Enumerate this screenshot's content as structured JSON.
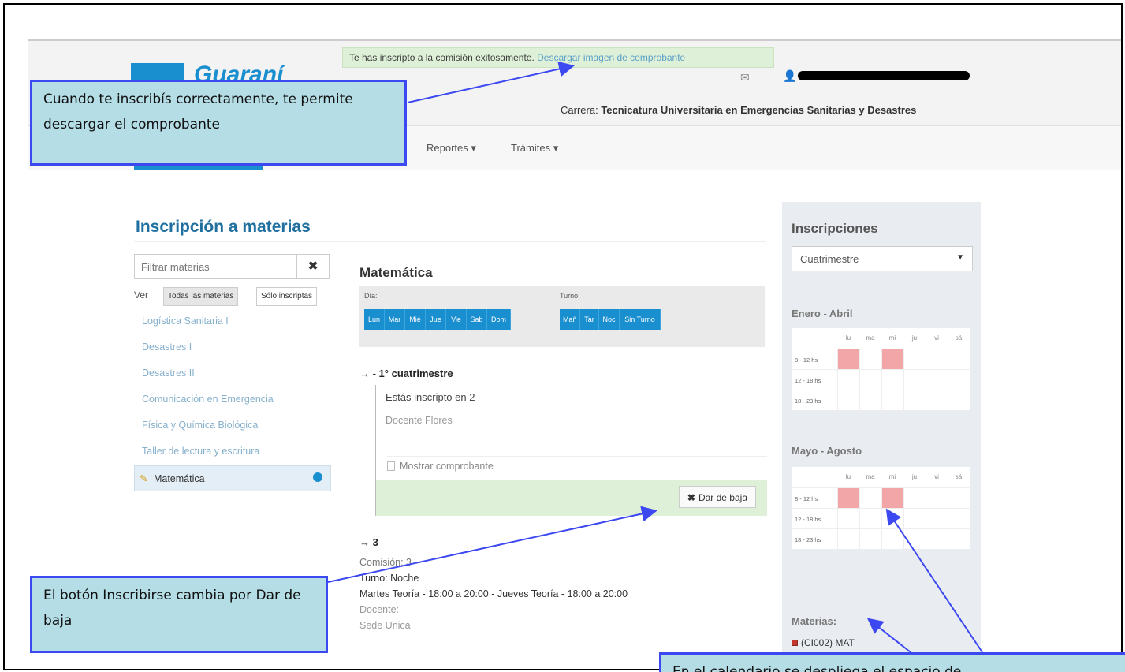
{
  "header": {
    "logo_text": "Guaraní",
    "success_message": "Te has inscripto a la comisión exitosamente.",
    "success_link": "Descargar imagen de comprobante",
    "carrera_label": "Carrera:",
    "carrera_value": "Tecnicatura Universitaria en Emergencias Sanitarias y Desastres"
  },
  "nav": {
    "items": [
      "Reportes ▾",
      "Trámites ▾"
    ]
  },
  "page": {
    "title": "Inscripción a materias"
  },
  "filter": {
    "placeholder": "Filtrar materias",
    "clear_icon": "✖",
    "ver_label": "Ver",
    "toggle_all": "Todas las materias",
    "toggle_inscriptas": "Sólo inscriptas"
  },
  "materias": [
    "Logística Sanitaria I",
    "Desastres I",
    "Desastres II",
    "Comunicación en Emergencia",
    "Física y Química Biológica",
    "Taller de lectura y escritura",
    "Matemática"
  ],
  "detail": {
    "title": "Matemática",
    "dia_label": "Día:",
    "turno_label": "Turno:",
    "dias": [
      "Lun",
      "Mar",
      "Mié",
      "Jue",
      "Vie",
      "Sab",
      "Dom"
    ],
    "turnos": [
      "Mañ",
      "Tar",
      "Noc",
      "Sin Turno"
    ],
    "cuat_heading": "→ - 1° cuatrimestre",
    "estas_inscripto": "Estás inscripto en 2",
    "docente": "Docente Flores",
    "mostrar_comprobante": "Mostrar comprobante",
    "baja_icon": "✖",
    "baja_label": "Dar de baja",
    "c3_heading": "→ 3",
    "c3_lines": [
      "Comisión: 3",
      "Turno: Noche",
      "Martes Teoría - 18:00 a 20:00 - Jueves Teoría - 18:00 a 20:00",
      "Docente:",
      "Sede Unica"
    ]
  },
  "sidebar": {
    "title": "Inscripciones",
    "period_select": "Cuatrimestre",
    "block1_title": "Enero - Abril",
    "block2_title": "Mayo - Agosto",
    "days": [
      "lu",
      "ma",
      "mi",
      "ju",
      "vi",
      "sá"
    ],
    "slots": [
      "8 - 12 hs",
      "12 - 18 hs",
      "18 - 23 hs"
    ],
    "materias_title": "Materias:",
    "materia_entry": "(CI002) MAT"
  },
  "annotations": {
    "callout1": "Cuando te inscribís correctamente, te permite descargar el comprobante",
    "callout2": "El botón Inscribirse cambia por Dar de baja",
    "callout3": "En el calendario se despliega el espacio de"
  },
  "colors": {
    "brand": "#1a8fd0",
    "success_bg": "#dff0d8",
    "callout_bg": "#b4dde6",
    "callout_border": "#3d49f0",
    "busy_slot": "#f2a6a8"
  }
}
